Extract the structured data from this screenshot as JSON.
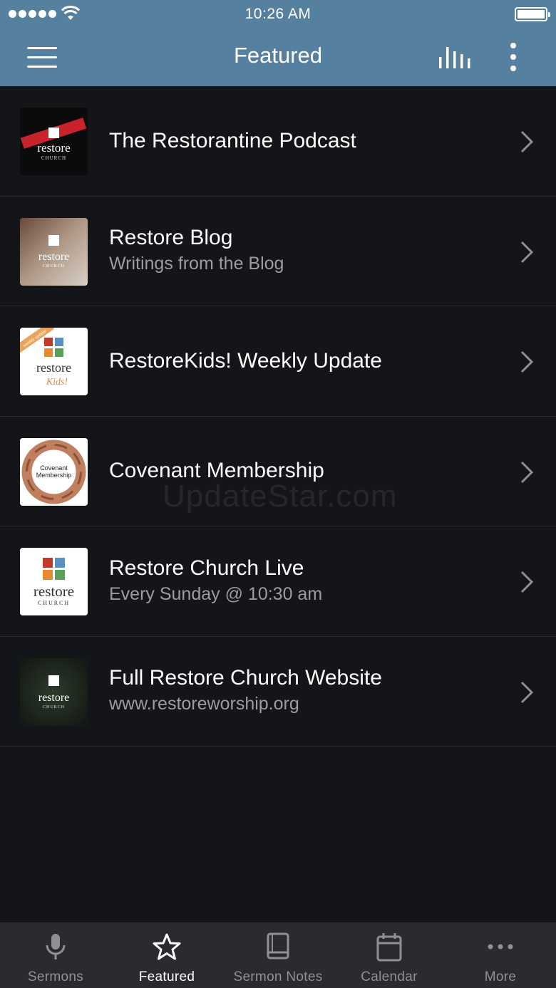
{
  "status_bar": {
    "time": "10:26 AM"
  },
  "nav": {
    "title": "Featured"
  },
  "items": [
    {
      "title": "The Restorantine Podcast",
      "subtitle": "",
      "thumb_brand": "restore",
      "thumb_tag": "CHURCH"
    },
    {
      "title": "Restore Blog",
      "subtitle": "Writings from the Blog",
      "thumb_brand": "restore",
      "thumb_tag": "CHURCH"
    },
    {
      "title": "RestoreKids! Weekly Update",
      "subtitle": "",
      "thumb_brand": "restore",
      "thumb_tag": "Kids!",
      "thumb_ribbon": "weekly update"
    },
    {
      "title": "Covenant Membership",
      "subtitle": "",
      "thumb_brand": "Covenant",
      "thumb_tag": "Membership"
    },
    {
      "title": "Restore Church Live",
      "subtitle": "Every Sunday @ 10:30 am",
      "thumb_brand": "restore",
      "thumb_tag": "CHURCH"
    },
    {
      "title": "Full Restore Church Website",
      "subtitle": "www.restoreworship.org",
      "thumb_brand": "restore",
      "thumb_tag": "CHURCH"
    }
  ],
  "watermark": "UpdateStar.com",
  "tabs": [
    {
      "label": "Sermons",
      "icon": "microphone-icon",
      "active": false
    },
    {
      "label": "Featured",
      "icon": "star-icon",
      "active": true
    },
    {
      "label": "Sermon Notes",
      "icon": "book-icon",
      "active": false
    },
    {
      "label": "Calendar",
      "icon": "calendar-icon",
      "active": false
    },
    {
      "label": "More",
      "icon": "more-dots-icon",
      "active": false
    }
  ],
  "colors": {
    "header": "#5680a0",
    "background": "#141518",
    "tab_bar": "#2a2b2f",
    "active_tab": "#ffffff",
    "inactive_tab": "#8e9096"
  }
}
